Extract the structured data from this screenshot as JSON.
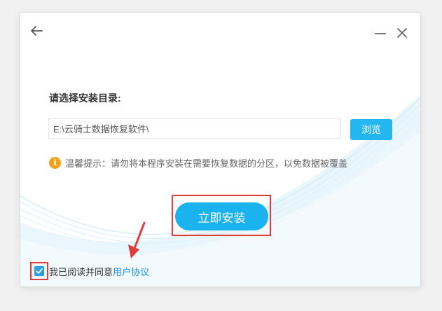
{
  "installer": {
    "label": "请选择安装目录:",
    "path_value": "E:\\云骑士数据恢复软件\\",
    "browse_label": "浏览",
    "tip_icon": "i",
    "tip_text": "温馨提示：请勿将本程序安装在需要恢复数据的分区，以免数据被覆盖",
    "install_label": "立即安装",
    "agree_text": "我已阅读并同意",
    "agreement_link": "用户协议",
    "agree_checked": true
  },
  "icons": {
    "back": "arrow-left-icon",
    "minimize": "minimize-icon",
    "close": "close-icon",
    "info": "info-icon",
    "check": "check-icon"
  },
  "colors": {
    "accent": "#1ab3ef",
    "highlight": "#e03c3c",
    "tip_icon": "#f4a118",
    "link": "#1a8fe0"
  }
}
